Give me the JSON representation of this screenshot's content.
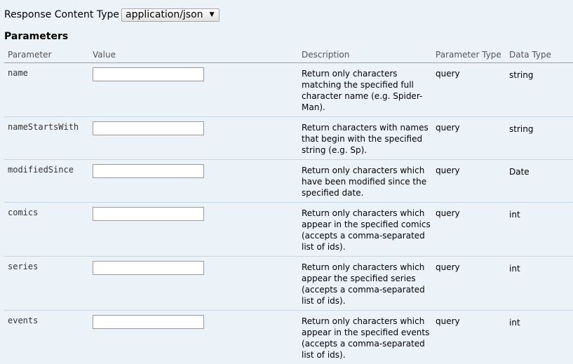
{
  "response": {
    "label": "Response Content Type",
    "selected": "application/json",
    "arrow": "▼"
  },
  "parameters": {
    "title": "Parameters",
    "headers": {
      "parameter": "Parameter",
      "value": "Value",
      "description": "Description",
      "parameter_type": "Parameter Type",
      "data_type": "Data Type"
    },
    "rows": [
      {
        "name": "name",
        "value": "",
        "description": "Return only characters matching the specified full character name (e.g. Spider-Man).",
        "param_type": "query",
        "data_type": "string"
      },
      {
        "name": "nameStartsWith",
        "value": "",
        "description": "Return characters with names that begin with the specified string (e.g. Sp).",
        "param_type": "query",
        "data_type": "string"
      },
      {
        "name": "modifiedSince",
        "value": "",
        "description": "Return only characters which have been modified since the specified date.",
        "param_type": "query",
        "data_type": "Date"
      },
      {
        "name": "comics",
        "value": "",
        "description": "Return only characters which appear in the specified comics (accepts a comma-separated list of ids).",
        "param_type": "query",
        "data_type": "int"
      },
      {
        "name": "series",
        "value": "",
        "description": "Return only characters which appear the specified series (accepts a comma-separated list of ids).",
        "param_type": "query",
        "data_type": "int"
      },
      {
        "name": "events",
        "value": "",
        "description": "Return only characters which appear in the specified events (accepts a comma-separated list of ids).",
        "param_type": "query",
        "data_type": "int"
      }
    ]
  }
}
